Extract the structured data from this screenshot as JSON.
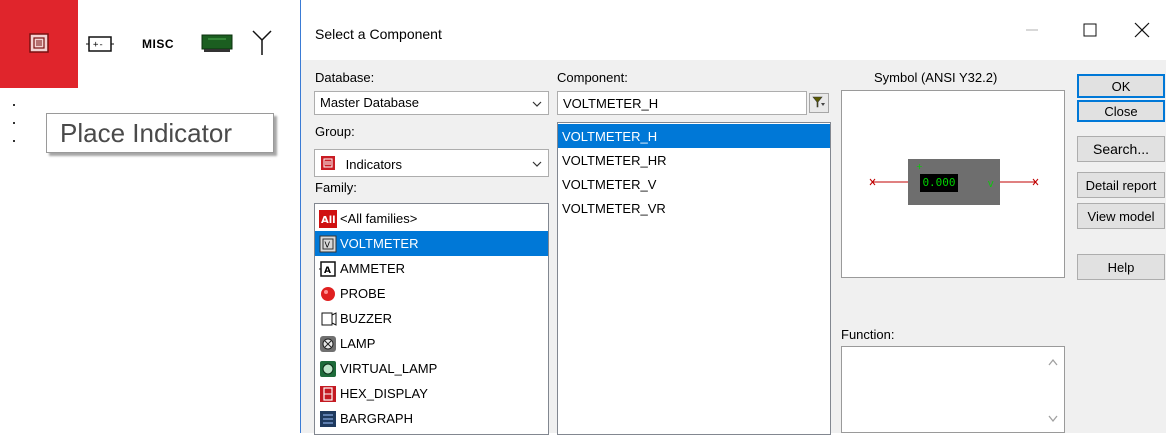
{
  "toolbar": {
    "misc_label": "MISC",
    "tooltip": "Place Indicator"
  },
  "dialog": {
    "title": "Select a Component",
    "database_label": "Database:",
    "database_value": "Master Database",
    "group_label": "Group:",
    "group_value": "Indicators",
    "family_label": "Family:",
    "families": [
      {
        "label": "<All families>",
        "icon": "all-families-icon"
      },
      {
        "label": "VOLTMETER",
        "icon": "voltmeter-icon",
        "selected": true
      },
      {
        "label": "AMMETER",
        "icon": "ammeter-icon"
      },
      {
        "label": "PROBE",
        "icon": "probe-icon"
      },
      {
        "label": "BUZZER",
        "icon": "buzzer-icon"
      },
      {
        "label": "LAMP",
        "icon": "lamp-icon"
      },
      {
        "label": "VIRTUAL_LAMP",
        "icon": "virtual-lamp-icon"
      },
      {
        "label": "HEX_DISPLAY",
        "icon": "hex-display-icon"
      },
      {
        "label": "BARGRAPH",
        "icon": "bargraph-icon"
      }
    ],
    "component_label": "Component:",
    "component_value": "VOLTMETER_H",
    "components": [
      {
        "label": "VOLTMETER_H",
        "selected": true
      },
      {
        "label": "VOLTMETER_HR"
      },
      {
        "label": "VOLTMETER_V"
      },
      {
        "label": "VOLTMETER_VR"
      }
    ],
    "symbol_label": "Symbol (ANSI Y32.2)",
    "symbol_reading": "0.000",
    "function_label": "Function:",
    "buttons": {
      "ok": "OK",
      "close": "Close",
      "search": "Search...",
      "detail_report": "Detail report",
      "view_model": "View model",
      "help": "Help"
    }
  },
  "colors": {
    "toolbar_highlight": "#e0252c",
    "selection": "#0078d7",
    "meter_display": "#00d000"
  }
}
